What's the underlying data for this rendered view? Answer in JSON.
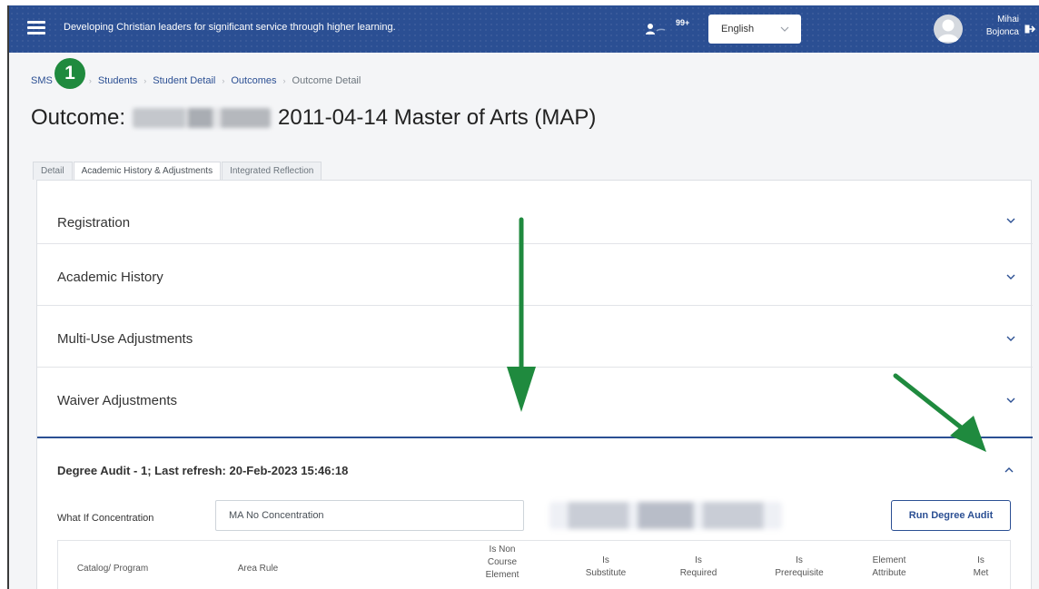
{
  "topbar": {
    "tagline": "Developing Christian leaders for significant service through higher learning.",
    "notification_count": "99+",
    "language": "English",
    "user_name_line1": "Mihai",
    "user_name_line2": "Bojonca"
  },
  "breadcrumb": {
    "items": [
      "SMS",
      "Students",
      "Student Detail",
      "Outcomes"
    ],
    "current": "Outcome Detail"
  },
  "step_badge": "1",
  "page": {
    "title_prefix": "Outcome:",
    "title_suffix": "2011-04-14 Master of Arts (MAP)"
  },
  "tabs": [
    {
      "label": "Detail",
      "active": false
    },
    {
      "label": "Academic History & Adjustments",
      "active": true
    },
    {
      "label": "Integrated Reflection",
      "active": false
    }
  ],
  "accordion": [
    {
      "label": "Registration",
      "expanded": false
    },
    {
      "label": "Academic History",
      "expanded": false
    },
    {
      "label": "Multi-Use Adjustments",
      "expanded": false
    },
    {
      "label": "Waiver Adjustments",
      "expanded": false
    }
  ],
  "degree_audit": {
    "title": "Degree Audit - 1; Last refresh: 20-Feb-2023 15:46:18",
    "expanded": true,
    "what_if_label": "What If Concentration",
    "what_if_value": "MA No Concentration",
    "run_button": "Run Degree Audit",
    "columns": [
      [
        "Catalog/ Program"
      ],
      [
        "Area Rule"
      ],
      [
        "Is Non",
        "Course",
        "Element"
      ],
      [
        "Is",
        "Substitute"
      ],
      [
        "Is",
        "Required"
      ],
      [
        "Is",
        "Prerequisite"
      ],
      [
        "Element",
        "Attribute"
      ],
      [
        "Is",
        "Met"
      ]
    ]
  },
  "colors": {
    "brand": "#2b4f93",
    "annotation": "#1f8a3e"
  },
  "icons": [
    "hamburger-icon",
    "users-icon",
    "chevron-down-icon",
    "avatar-icon",
    "logout-icon",
    "chevron-up-icon",
    "arrow-down-annotation",
    "arrow-diagonal-annotation"
  ]
}
